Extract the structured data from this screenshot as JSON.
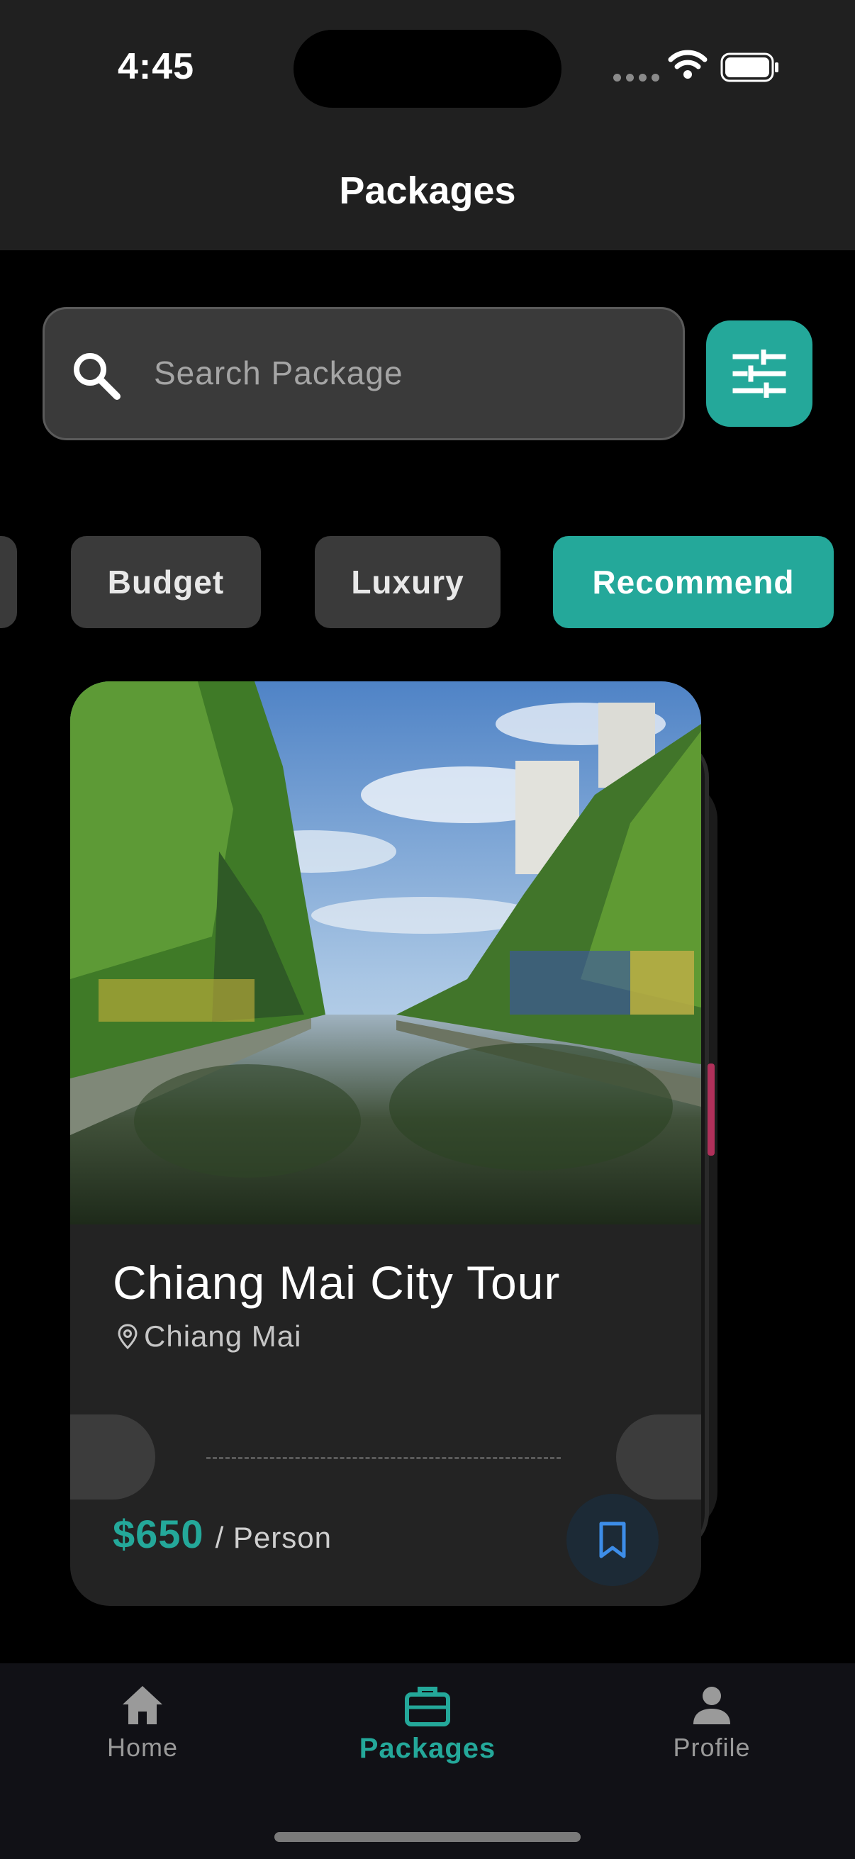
{
  "status_bar": {
    "time": "4:45"
  },
  "header": {
    "title": "Packages"
  },
  "search": {
    "placeholder": "Search Package",
    "value": ""
  },
  "filter_button": {
    "icon": "sliders-icon"
  },
  "chips": [
    {
      "label": "",
      "active": false
    },
    {
      "label": "Budget",
      "active": false
    },
    {
      "label": "Luxury",
      "active": false
    },
    {
      "label": "Recommend",
      "active": true
    }
  ],
  "card": {
    "title": "Chiang Mai City Tour",
    "location": "Chiang Mai",
    "price": "$650",
    "price_unit": "/ Person",
    "image": "canal-with-trees-photo"
  },
  "bottom_nav": {
    "items": [
      {
        "label": "Home",
        "icon": "home-icon",
        "active": false
      },
      {
        "label": "Packages",
        "icon": "briefcase-icon",
        "active": true
      },
      {
        "label": "Profile",
        "icon": "person-icon",
        "active": false
      }
    ]
  },
  "colors": {
    "accent": "#24a89a",
    "background": "#000000",
    "surface": "#232323",
    "header": "#202020"
  }
}
